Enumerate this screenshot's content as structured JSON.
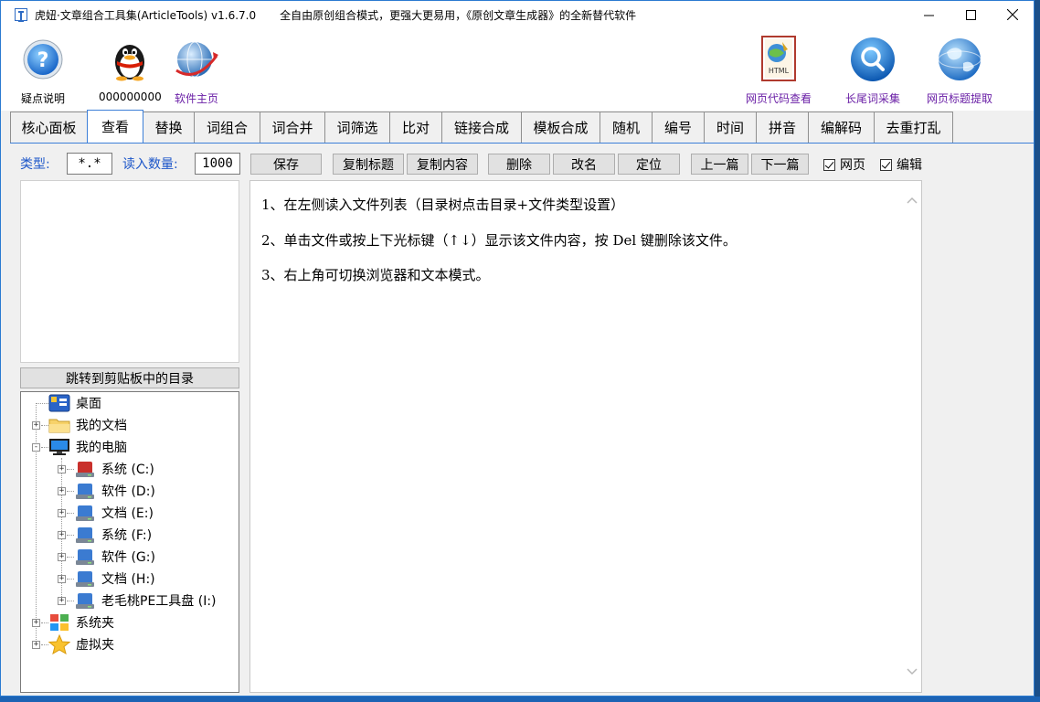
{
  "window": {
    "title": "虎妞·文章组合工具集(ArticleTools) v1.6.7.0",
    "slogan": "全自由原创组合模式，更强大更易用，《原创文章生成器》的全新替代软件",
    "controls": {
      "minimize": "—",
      "maximize": "☐",
      "close": "✕"
    }
  },
  "toolbar": {
    "left": [
      {
        "label": "疑点说明",
        "icon": "help-icon"
      },
      {
        "label": "000000000",
        "icon": "qq-penguin-icon"
      },
      {
        "label": "软件主页",
        "icon": "globe-icon"
      }
    ],
    "right": [
      {
        "label": "网页代码查看",
        "icon": "html-file-icon"
      },
      {
        "label": "长尾词采集",
        "icon": "search-icon"
      },
      {
        "label": "网页标题提取",
        "icon": "web-globe-icon"
      }
    ]
  },
  "tabs": [
    {
      "label": "核心面板"
    },
    {
      "label": "查看",
      "active": true
    },
    {
      "label": "替换"
    },
    {
      "label": "词组合"
    },
    {
      "label": "词合并"
    },
    {
      "label": "词筛选"
    },
    {
      "label": "比对"
    },
    {
      "label": "链接合成"
    },
    {
      "label": "模板合成"
    },
    {
      "label": "随机"
    },
    {
      "label": "编号"
    },
    {
      "label": "时间"
    },
    {
      "label": "拼音"
    },
    {
      "label": "编解码"
    },
    {
      "label": "去重打乱"
    }
  ],
  "controls": {
    "type_label": "类型:",
    "type_value": "*.*",
    "count_label": "读入数量:",
    "count_value": "1000",
    "save": "保存",
    "copy_title": "复制标题",
    "copy_content": "复制内容",
    "delete": "删除",
    "rename": "改名",
    "locate": "定位",
    "prev": "上一篇",
    "next": "下一篇",
    "web_checkbox": "网页",
    "edit_checkbox": "编辑",
    "web_checked": true,
    "edit_checked": true
  },
  "left": {
    "jump_button": "跳转到剪贴板中的目录",
    "tree": [
      {
        "label": "桌面",
        "icon": "desktop-icon",
        "level": 0,
        "exp": ""
      },
      {
        "label": "我的文档",
        "icon": "folder-icon",
        "level": 0,
        "exp": "+"
      },
      {
        "label": "我的电脑",
        "icon": "computer-icon",
        "level": 0,
        "exp": "-"
      },
      {
        "label": "系统 (C:)",
        "icon": "system-drive-icon",
        "level": 1,
        "exp": "+"
      },
      {
        "label": "软件 (D:)",
        "icon": "drive-icon",
        "level": 1,
        "exp": "+"
      },
      {
        "label": "文档 (E:)",
        "icon": "drive-icon",
        "level": 1,
        "exp": "+"
      },
      {
        "label": "系统 (F:)",
        "icon": "drive-icon",
        "level": 1,
        "exp": "+"
      },
      {
        "label": "软件 (G:)",
        "icon": "drive-icon",
        "level": 1,
        "exp": "+"
      },
      {
        "label": "文档 (H:)",
        "icon": "drive-icon",
        "level": 1,
        "exp": "+"
      },
      {
        "label": "老毛桃PE工具盘 (I:)",
        "icon": "drive-icon",
        "level": 1,
        "exp": "+"
      },
      {
        "label": "系统夹",
        "icon": "windows-icon",
        "level": 0,
        "exp": "+"
      },
      {
        "label": "虚拟夹",
        "icon": "star-icon",
        "level": 0,
        "exp": "+"
      }
    ]
  },
  "content": {
    "lines": [
      "1、在左侧读入文件列表（目录树点击目录+文件类型设置）",
      "2、单击文件或按上下光标键（↑↓）显示该文件内容，按 Del 键删除该文件。",
      "3、右上角可切换浏览器和文本模式。"
    ]
  },
  "colors": {
    "accent": "#1c56c9",
    "purple": "#6a1fa6",
    "tab_border": "#3c7fd8"
  }
}
